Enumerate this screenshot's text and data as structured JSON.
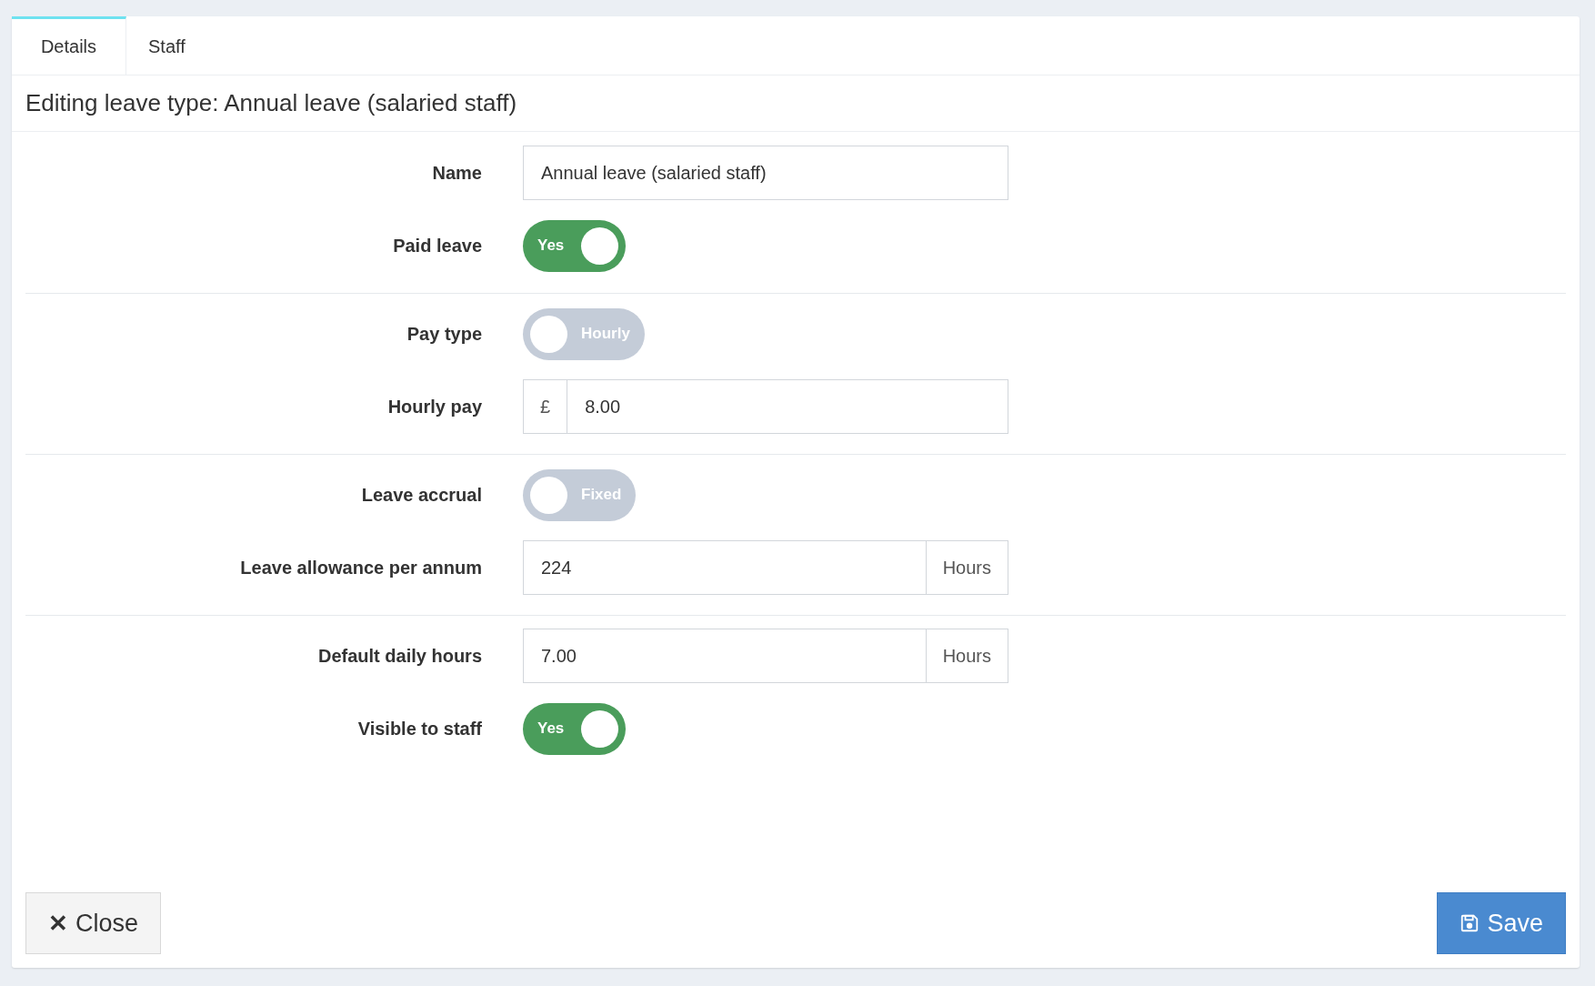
{
  "tabs": [
    {
      "label": "Details",
      "selected": true
    },
    {
      "label": "Staff",
      "selected": false
    }
  ],
  "title": "Editing leave type: Annual leave (salaried staff)",
  "sections": [
    [
      {
        "kind": "text",
        "label": "Name",
        "value": "Annual leave (salaried staff)"
      },
      {
        "kind": "toggle",
        "label": "Paid leave",
        "on": true,
        "text": "Yes"
      }
    ],
    [
      {
        "kind": "toggle",
        "label": "Pay type",
        "on": false,
        "text": "Hourly"
      },
      {
        "kind": "prefix",
        "label": "Hourly pay",
        "addon": "£",
        "value": "8.00"
      }
    ],
    [
      {
        "kind": "toggle",
        "label": "Leave accrual",
        "on": false,
        "text": "Fixed"
      },
      {
        "kind": "suffix",
        "label": "Leave allowance per annum",
        "addon": "Hours",
        "value": "224"
      }
    ],
    [
      {
        "kind": "suffix",
        "label": "Default daily hours",
        "addon": "Hours",
        "value": "7.00"
      },
      {
        "kind": "toggle",
        "label": "Visible to staff",
        "on": true,
        "text": "Yes"
      }
    ]
  ],
  "buttons": {
    "close": {
      "icon": "✕",
      "label": "Close"
    },
    "save": {
      "label": "Save"
    }
  }
}
